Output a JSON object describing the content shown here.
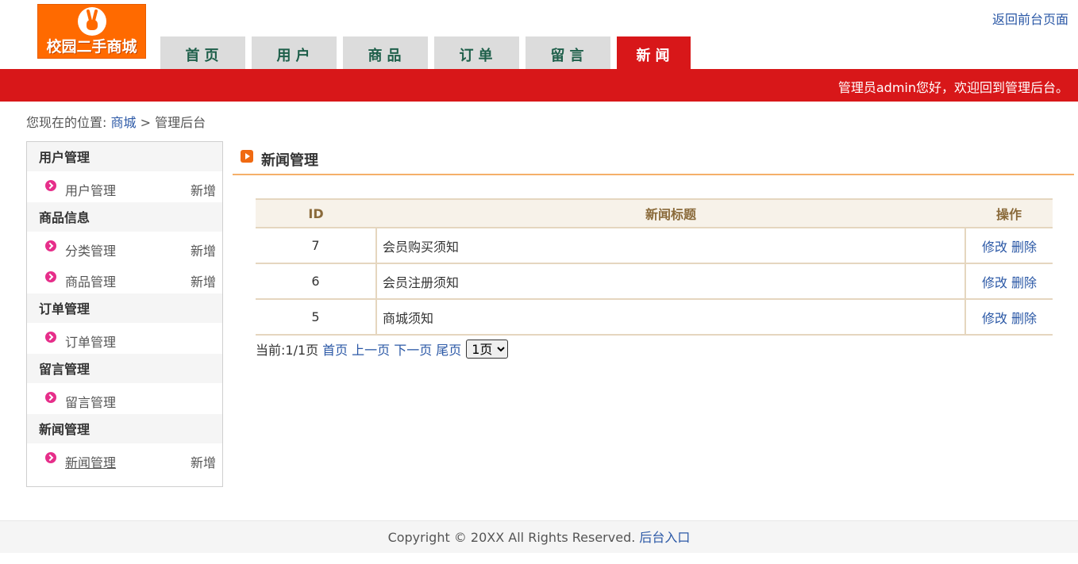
{
  "header": {
    "logo_text": "校园二手商城",
    "back_link": "返回前台页面",
    "welcome": "管理员admin您好，欢迎回到管理后台。"
  },
  "nav": {
    "tabs": [
      {
        "label": "首页",
        "active": false
      },
      {
        "label": "用户",
        "active": false
      },
      {
        "label": "商品",
        "active": false
      },
      {
        "label": "订单",
        "active": false
      },
      {
        "label": "留言",
        "active": false
      },
      {
        "label": "新闻",
        "active": true
      }
    ]
  },
  "breadcrumb": {
    "prefix": "您现在的位置:",
    "link": "商城",
    "separator": ">",
    "current": "管理后台"
  },
  "sidebar": {
    "groups": [
      {
        "title": "用户管理",
        "items": [
          {
            "label": "用户管理",
            "add": "新增"
          }
        ]
      },
      {
        "title": "商品信息",
        "items": [
          {
            "label": "分类管理",
            "add": "新增"
          },
          {
            "label": "商品管理",
            "add": "新增"
          }
        ]
      },
      {
        "title": "订单管理",
        "items": [
          {
            "label": "订单管理",
            "add": ""
          }
        ]
      },
      {
        "title": "留言管理",
        "items": [
          {
            "label": "留言管理",
            "add": ""
          }
        ]
      },
      {
        "title": "新闻管理",
        "items": [
          {
            "label": "新闻管理",
            "add": "新增"
          }
        ]
      }
    ]
  },
  "main": {
    "section_title": "新闻管理",
    "table": {
      "headers": [
        "ID",
        "新闻标题",
        "操作"
      ],
      "rows": [
        {
          "id": "7",
          "title": "会员购买须知",
          "edit": "修改",
          "delete": "删除"
        },
        {
          "id": "6",
          "title": "会员注册须知",
          "edit": "修改",
          "delete": "删除"
        },
        {
          "id": "5",
          "title": "商城须知",
          "edit": "修改",
          "delete": "删除"
        }
      ]
    },
    "pager": {
      "status": "当前:1/1页",
      "first": "首页",
      "prev": "上一页",
      "next": "下一页",
      "last": "尾页",
      "selected": "1页"
    }
  },
  "footer": {
    "copyright": "Copyright © 20XX All Rights Reserved.",
    "admin_link": "后台入口"
  },
  "colors": {
    "brand_red": "#d81719",
    "logo_orange": "#ff6a00",
    "link_blue": "#2b58a6",
    "nav_text_green": "#1e5f4a"
  }
}
